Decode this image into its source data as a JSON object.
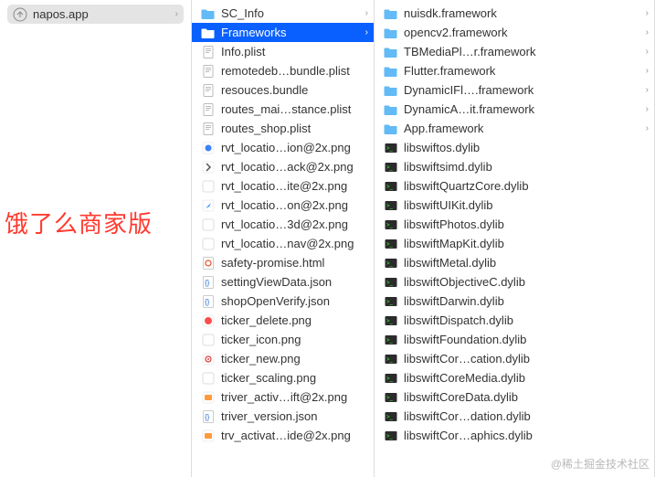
{
  "overlay_text": "饿了么商家版",
  "watermark": "@稀土掘金技术社区",
  "col1": {
    "items": [
      {
        "label": "napos.app",
        "icon": "app",
        "chev": true,
        "sel": "app"
      }
    ]
  },
  "col2": {
    "items": [
      {
        "label": "SC_Info",
        "icon": "folder",
        "chev": true
      },
      {
        "label": "Frameworks",
        "icon": "folder",
        "chev": true,
        "sel": "blue"
      },
      {
        "label": "Info.plist",
        "icon": "plist"
      },
      {
        "label": "remotedeb…bundle.plist",
        "icon": "plist"
      },
      {
        "label": "resouces.bundle",
        "icon": "plist"
      },
      {
        "label": "routes_mai…stance.plist",
        "icon": "plist"
      },
      {
        "label": "routes_shop.plist",
        "icon": "plist"
      },
      {
        "label": "rvt_locatio…ion@2x.png",
        "icon": "png-blue"
      },
      {
        "label": "rvt_locatio…ack@2x.png",
        "icon": "png-arrow"
      },
      {
        "label": "rvt_locatio…ite@2x.png",
        "icon": "png-white"
      },
      {
        "label": "rvt_locatio…on@2x.png",
        "icon": "png-nav"
      },
      {
        "label": "rvt_locatio…3d@2x.png",
        "icon": "png-white"
      },
      {
        "label": "rvt_locatio…nav@2x.png",
        "icon": "png-white"
      },
      {
        "label": "safety-promise.html",
        "icon": "html"
      },
      {
        "label": "settingViewData.json",
        "icon": "json"
      },
      {
        "label": "shopOpenVerify.json",
        "icon": "json"
      },
      {
        "label": "ticker_delete.png",
        "icon": "png-red"
      },
      {
        "label": "ticker_icon.png",
        "icon": "png-white"
      },
      {
        "label": "ticker_new.png",
        "icon": "png-target"
      },
      {
        "label": "ticker_scaling.png",
        "icon": "png-white"
      },
      {
        "label": "triver_activ…ift@2x.png",
        "icon": "png-orange"
      },
      {
        "label": "triver_version.json",
        "icon": "json"
      },
      {
        "label": "trv_activat…ide@2x.png",
        "icon": "png-orange"
      }
    ]
  },
  "col3": {
    "items": [
      {
        "label": "nuisdk.framework",
        "icon": "folder",
        "chev": true
      },
      {
        "label": "opencv2.framework",
        "icon": "folder",
        "chev": true
      },
      {
        "label": "TBMediaPl…r.framework",
        "icon": "folder",
        "chev": true
      },
      {
        "label": "Flutter.framework",
        "icon": "folder",
        "chev": true
      },
      {
        "label": "DynamicIFl….framework",
        "icon": "folder",
        "chev": true
      },
      {
        "label": "DynamicA…it.framework",
        "icon": "folder",
        "chev": true
      },
      {
        "label": "App.framework",
        "icon": "folder",
        "chev": true
      },
      {
        "label": "libswiftos.dylib",
        "icon": "exec"
      },
      {
        "label": "libswiftsimd.dylib",
        "icon": "exec"
      },
      {
        "label": "libswiftQuartzCore.dylib",
        "icon": "exec"
      },
      {
        "label": "libswiftUIKit.dylib",
        "icon": "exec"
      },
      {
        "label": "libswiftPhotos.dylib",
        "icon": "exec"
      },
      {
        "label": "libswiftMapKit.dylib",
        "icon": "exec"
      },
      {
        "label": "libswiftMetal.dylib",
        "icon": "exec"
      },
      {
        "label": "libswiftObjectiveC.dylib",
        "icon": "exec"
      },
      {
        "label": "libswiftDarwin.dylib",
        "icon": "exec"
      },
      {
        "label": "libswiftDispatch.dylib",
        "icon": "exec"
      },
      {
        "label": "libswiftFoundation.dylib",
        "icon": "exec"
      },
      {
        "label": "libswiftCor…cation.dylib",
        "icon": "exec"
      },
      {
        "label": "libswiftCoreMedia.dylib",
        "icon": "exec"
      },
      {
        "label": "libswiftCoreData.dylib",
        "icon": "exec"
      },
      {
        "label": "libswiftCor…dation.dylib",
        "icon": "exec"
      },
      {
        "label": "libswiftCor…aphics.dylib",
        "icon": "exec"
      }
    ]
  }
}
